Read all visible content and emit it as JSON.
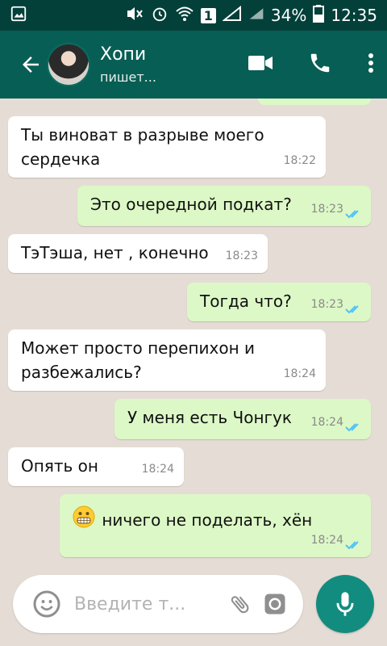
{
  "status": {
    "battery_percent": "34%",
    "time": "12:35",
    "sim_slot": "1"
  },
  "header": {
    "contact_name": "Хопи",
    "contact_status": "пишет..."
  },
  "messages": [
    {
      "text_lines": [
        "Ты виноват в разрыве моего",
        "сердечка"
      ],
      "time": "18:22",
      "direction": "in"
    },
    {
      "text": "Это очередной подкат?",
      "time": "18:23",
      "direction": "out"
    },
    {
      "text": "ТэТэша, нет , конечно",
      "time": "18:23",
      "direction": "in"
    },
    {
      "text": "Тогда что?",
      "time": "18:23",
      "direction": "out"
    },
    {
      "text_lines": [
        "Может просто перепихон и",
        "разбежались?"
      ],
      "time": "18:24",
      "direction": "in"
    },
    {
      "text": "У меня есть Чонгук",
      "time": "18:24",
      "direction": "out"
    },
    {
      "text": "Опять он",
      "time": "18:24",
      "direction": "in"
    },
    {
      "text": "ничего не поделать, хён",
      "time": "18:24",
      "direction": "out",
      "emoji": "grimace"
    }
  ],
  "input": {
    "placeholder": "Введите т..."
  },
  "colors": {
    "appbar": "#075e54",
    "statusbar": "#04403a",
    "incoming": "#ffffff",
    "outgoing": "#dcf8c6",
    "ticks": "#4fc3f7",
    "fab": "#128c7e"
  },
  "icons": [
    "image-icon",
    "mute-icon",
    "alarm-icon",
    "wifi-icon",
    "sim-icon",
    "signal-icon",
    "battery-icon",
    "back-arrow-icon",
    "videocam-icon",
    "phone-icon",
    "more-vert-icon",
    "emoji-icon",
    "attach-icon",
    "camera-icon",
    "mic-icon",
    "read-ticks-icon",
    "grimace-emoji-icon"
  ]
}
